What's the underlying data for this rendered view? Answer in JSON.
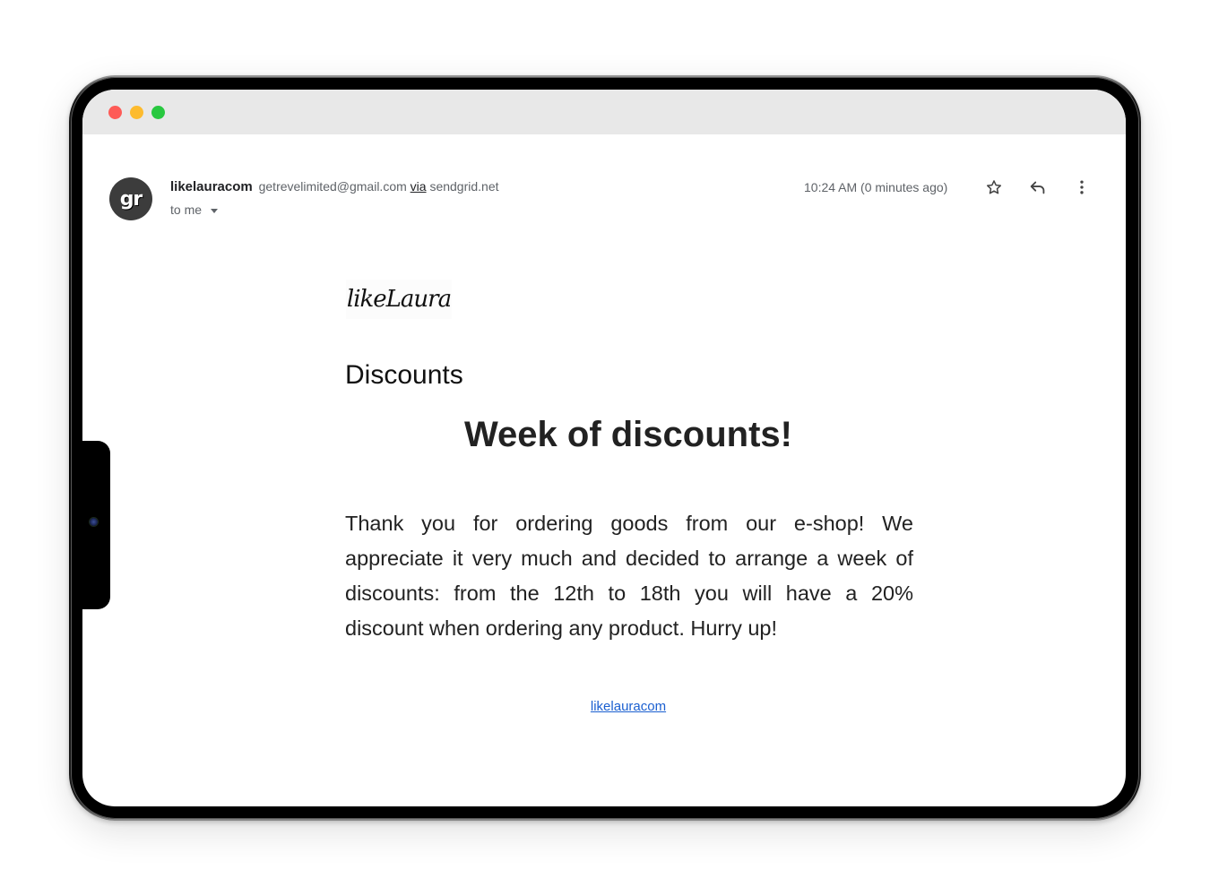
{
  "window": {
    "controls": [
      "close",
      "minimize",
      "maximize"
    ],
    "control_colors": {
      "close": "#fe5b57",
      "minimize": "#fdbb2e",
      "maximize": "#28c840"
    }
  },
  "email": {
    "avatar_initials": "gr",
    "sender_name": "likelauracom",
    "sender_email": "getrevelimited@gmail.com",
    "via_label": "via",
    "via_domain": "sendgrid.net",
    "recipient": "to me",
    "timestamp": "10:24 AM (0 minutes ago)",
    "actions": {
      "star": "star-icon",
      "reply": "reply-icon",
      "more": "more-vert-icon"
    }
  },
  "content": {
    "logo_text": "likeLaura",
    "section_title": "Discounts",
    "headline": "Week of discounts!",
    "body": "Thank you for ordering goods from our e-shop! We appreciate it very much and decided to arrange a week of discounts: from the 12th to 18th you will have a 20% discount when ordering any product. Hurry up!",
    "footer_link": "likelauracom"
  },
  "colors": {
    "link": "#1a5fd0",
    "avatar_bg": "#3c3c3c",
    "titlebar_bg": "#e8e8e8"
  }
}
